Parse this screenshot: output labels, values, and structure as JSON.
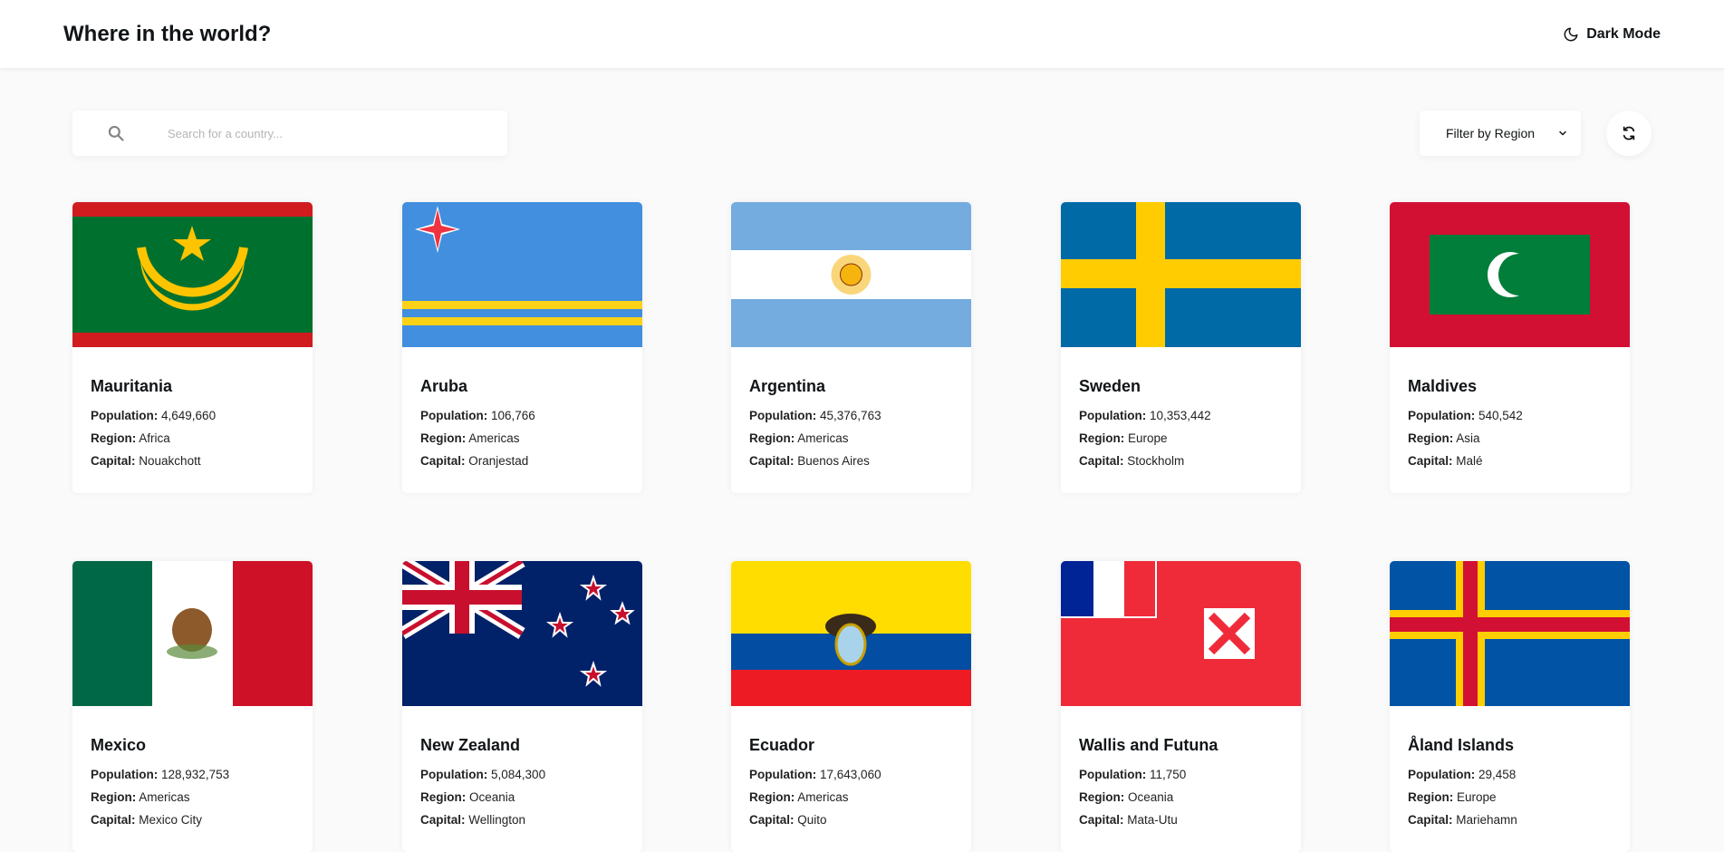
{
  "header": {
    "title": "Where in the world?",
    "mode_label": "Dark Mode"
  },
  "search": {
    "placeholder": "Search for a country..."
  },
  "filter": {
    "label": "Filter by Region"
  },
  "labels": {
    "population": "Population:",
    "region": "Region:",
    "capital": "Capital:"
  },
  "countries": [
    {
      "name": "Mauritania",
      "population": "4,649,660",
      "region": "Africa",
      "capital": "Nouakchott"
    },
    {
      "name": "Aruba",
      "population": "106,766",
      "region": "Americas",
      "capital": "Oranjestad"
    },
    {
      "name": "Argentina",
      "population": "45,376,763",
      "region": "Americas",
      "capital": "Buenos Aires"
    },
    {
      "name": "Sweden",
      "population": "10,353,442",
      "region": "Europe",
      "capital": "Stockholm"
    },
    {
      "name": "Maldives",
      "population": "540,542",
      "region": "Asia",
      "capital": "Malé"
    },
    {
      "name": "Mexico",
      "population": "128,932,753",
      "region": "Americas",
      "capital": "Mexico City"
    },
    {
      "name": "New Zealand",
      "population": "5,084,300",
      "region": "Oceania",
      "capital": "Wellington"
    },
    {
      "name": "Ecuador",
      "population": "17,643,060",
      "region": "Americas",
      "capital": "Quito"
    },
    {
      "name": "Wallis and Futuna",
      "population": "11,750",
      "region": "Oceania",
      "capital": "Mata-Utu"
    },
    {
      "name": "Åland Islands",
      "population": "29,458",
      "region": "Europe",
      "capital": "Mariehamn"
    }
  ]
}
